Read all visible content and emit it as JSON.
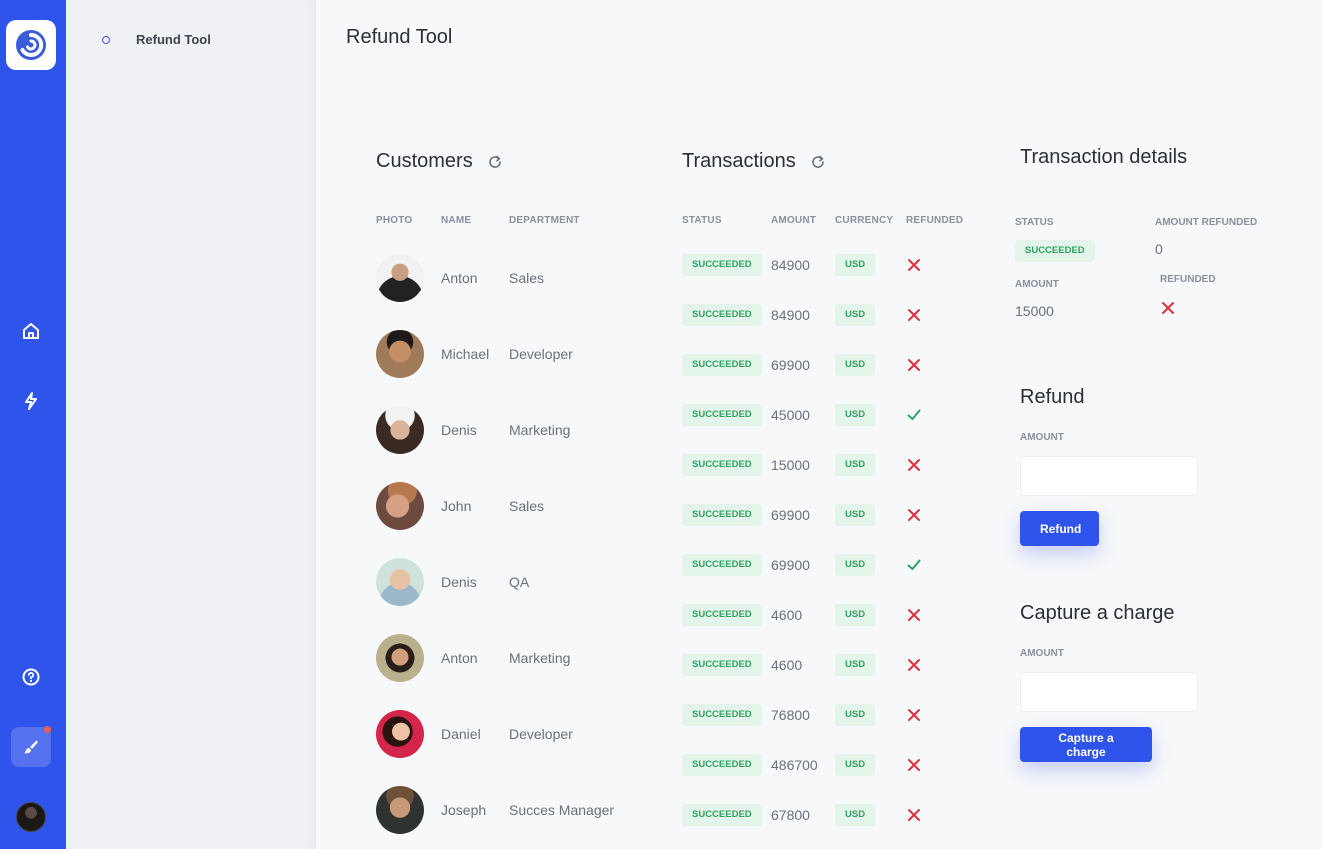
{
  "page": {
    "title": "Refund Tool"
  },
  "subnav": {
    "items": [
      {
        "label": "Refund Tool"
      }
    ]
  },
  "rail": {
    "icons": [
      "logo-icon",
      "home-icon",
      "bolt-icon",
      "help-icon",
      "brush-icon",
      "avatar"
    ]
  },
  "colors": {
    "accent": "#2f54eb",
    "success_bg": "#e3f4ea",
    "success": "#2ea362",
    "danger": "#e0303c"
  },
  "customers": {
    "title": "Customers",
    "columns": [
      "PHOTO",
      "NAME",
      "DEPARTMENT"
    ],
    "rows": [
      {
        "name": "Anton",
        "department": "Sales"
      },
      {
        "name": "Michael",
        "department": "Developer"
      },
      {
        "name": "Denis",
        "department": "Marketing"
      },
      {
        "name": "John",
        "department": "Sales"
      },
      {
        "name": "Denis",
        "department": "QA"
      },
      {
        "name": "Anton",
        "department": "Marketing"
      },
      {
        "name": "Daniel",
        "department": "Developer"
      },
      {
        "name": "Joseph",
        "department": "Succes Manager"
      }
    ]
  },
  "transactions": {
    "title": "Transactions",
    "columns": [
      "STATUS",
      "AMOUNT",
      "CURRENCY",
      "REFUNDED"
    ],
    "rows": [
      {
        "status": "SUCCEEDED",
        "amount": "84900",
        "currency": "USD",
        "refunded": false
      },
      {
        "status": "SUCCEEDED",
        "amount": "84900",
        "currency": "USD",
        "refunded": false
      },
      {
        "status": "SUCCEEDED",
        "amount": "69900",
        "currency": "USD",
        "refunded": false
      },
      {
        "status": "SUCCEEDED",
        "amount": "45000",
        "currency": "USD",
        "refunded": true
      },
      {
        "status": "SUCCEEDED",
        "amount": "15000",
        "currency": "USD",
        "refunded": false
      },
      {
        "status": "SUCCEEDED",
        "amount": "69900",
        "currency": "USD",
        "refunded": false
      },
      {
        "status": "SUCCEEDED",
        "amount": "69900",
        "currency": "USD",
        "refunded": true
      },
      {
        "status": "SUCCEEDED",
        "amount": "4600",
        "currency": "USD",
        "refunded": false
      },
      {
        "status": "SUCCEEDED",
        "amount": "4600",
        "currency": "USD",
        "refunded": false
      },
      {
        "status": "SUCCEEDED",
        "amount": "76800",
        "currency": "USD",
        "refunded": false
      },
      {
        "status": "SUCCEEDED",
        "amount": "486700",
        "currency": "USD",
        "refunded": false
      },
      {
        "status": "SUCCEEDED",
        "amount": "67800",
        "currency": "USD",
        "refunded": false
      }
    ]
  },
  "details": {
    "title": "Transaction details",
    "status_label": "STATUS",
    "status": "SUCCEEDED",
    "amount_refunded_label": "AMOUNT REFUNDED",
    "amount_refunded": "0",
    "amount_label": "AMOUNT",
    "amount": "15000",
    "refunded_label": "REFUNDED",
    "refunded": false
  },
  "refund": {
    "title": "Refund",
    "amount_label": "AMOUNT",
    "amount_value": "",
    "button": "Refund"
  },
  "capture": {
    "title": "Capture a charge",
    "amount_label": "AMOUNT",
    "amount_value": "",
    "button": "Capture a charge"
  }
}
